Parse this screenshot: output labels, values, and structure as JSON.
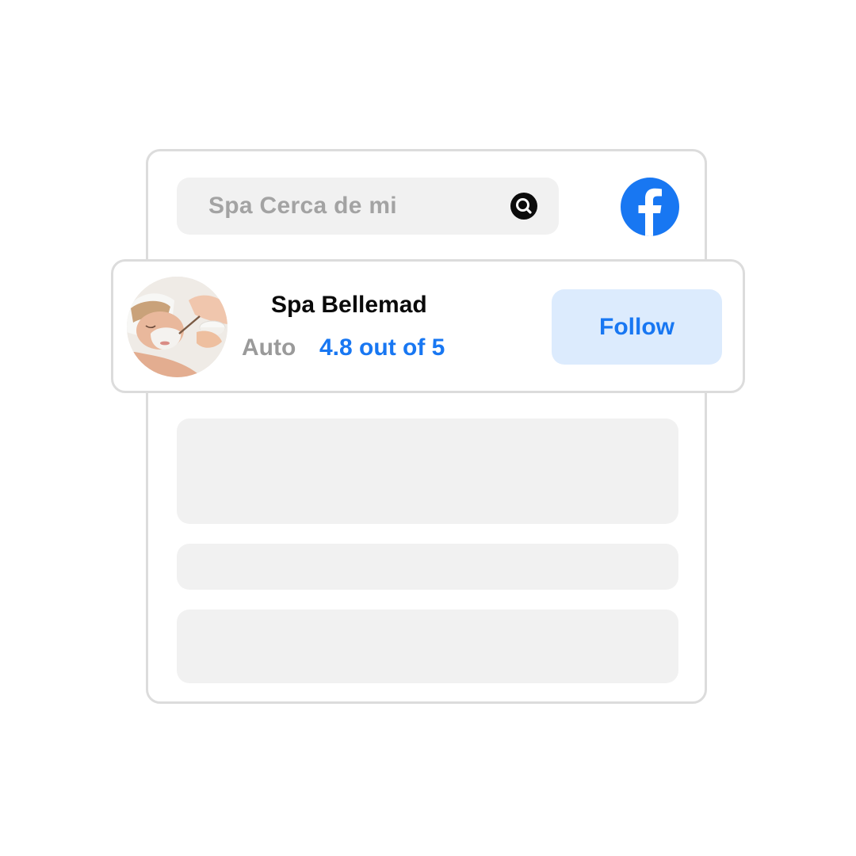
{
  "search": {
    "value": "Spa Cerca de mi",
    "icon": "search-icon"
  },
  "brand": {
    "icon": "facebook-icon",
    "color": "#1877f2"
  },
  "profile": {
    "name": "Spa Bellemad",
    "category": "Auto",
    "rating": "4.8 out of 5",
    "follow_label": "Follow",
    "avatar": "spa-facial-treatment-photo"
  },
  "colors": {
    "accent": "#1877f2",
    "follow_bg": "#dcebfd",
    "placeholder": "#f1f1f1",
    "border": "#dcdcdc"
  }
}
